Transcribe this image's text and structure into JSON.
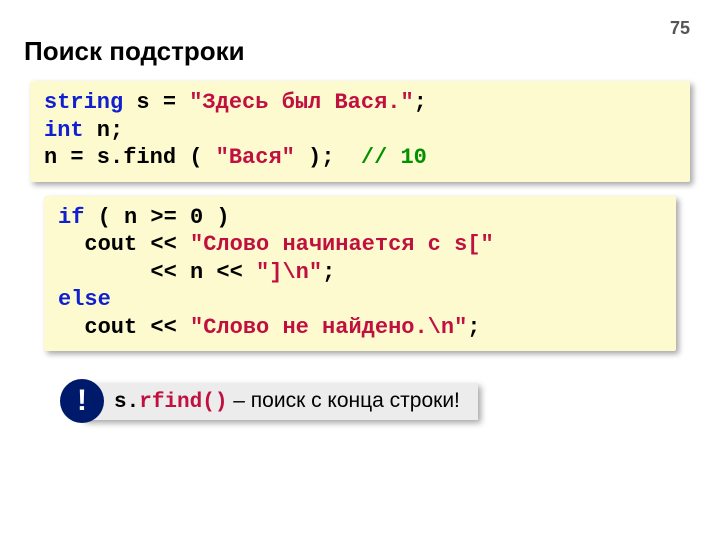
{
  "page_number": "75",
  "title": "Поиск подстроки",
  "code1": {
    "l1_kw": "string",
    "l1_rest": " s = ",
    "l1_str": "\"Здесь был Вася.\"",
    "l1_end": ";",
    "l2_kw": "int",
    "l2_rest": " n;",
    "l3_a": "n = s.",
    "l3_find": "find",
    "l3_b": " ( ",
    "l3_str": "\"Вася\"",
    "l3_c": " );  ",
    "l3_cmt": "// 10"
  },
  "code2": {
    "l1_kw": "if",
    "l1_rest": " ( n >= 0 )",
    "l2_a": "  cout << ",
    "l2_str": "\"Слово начинается с s[\"",
    "l3_a": "       << n << ",
    "l3_str": "\"]\\n\"",
    "l3_end": ";",
    "l4_kw": "else",
    "l5_a": "  cout << ",
    "l5_str": "\"Слово не найдено.\\n\"",
    "l5_end": ";"
  },
  "note": {
    "bang": "!",
    "pre": "s.",
    "func": "rfind()",
    "post": " – поиск с конца строки!"
  }
}
